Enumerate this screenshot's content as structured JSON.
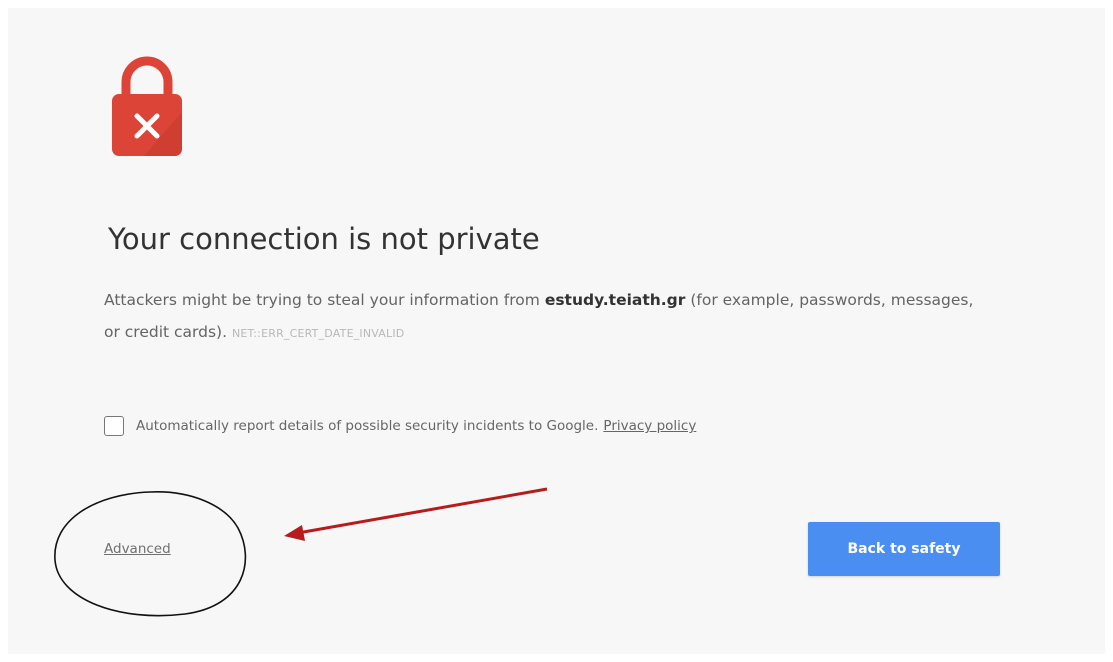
{
  "interstitial": {
    "lock_icon": "lock-error-icon",
    "heading": "Your connection is not private",
    "body_prefix": "Attackers might be trying to steal your information from ",
    "domain": "estudy.teiath.gr",
    "body_suffix": " (for example, passwords, messages, or credit cards). ",
    "error_code": "NET::ERR_CERT_DATE_INVALID",
    "report_checkbox_checked": false,
    "report_label": "Automatically report details of possible security incidents to Google.",
    "privacy_link": "Privacy policy",
    "advanced_link": "Advanced",
    "back_button": "Back to safety",
    "colors": {
      "lock": "#db4437",
      "button": "#4a8ef2",
      "annotation_arrow": "#b71c1c",
      "annotation_circle": "#111111"
    }
  }
}
